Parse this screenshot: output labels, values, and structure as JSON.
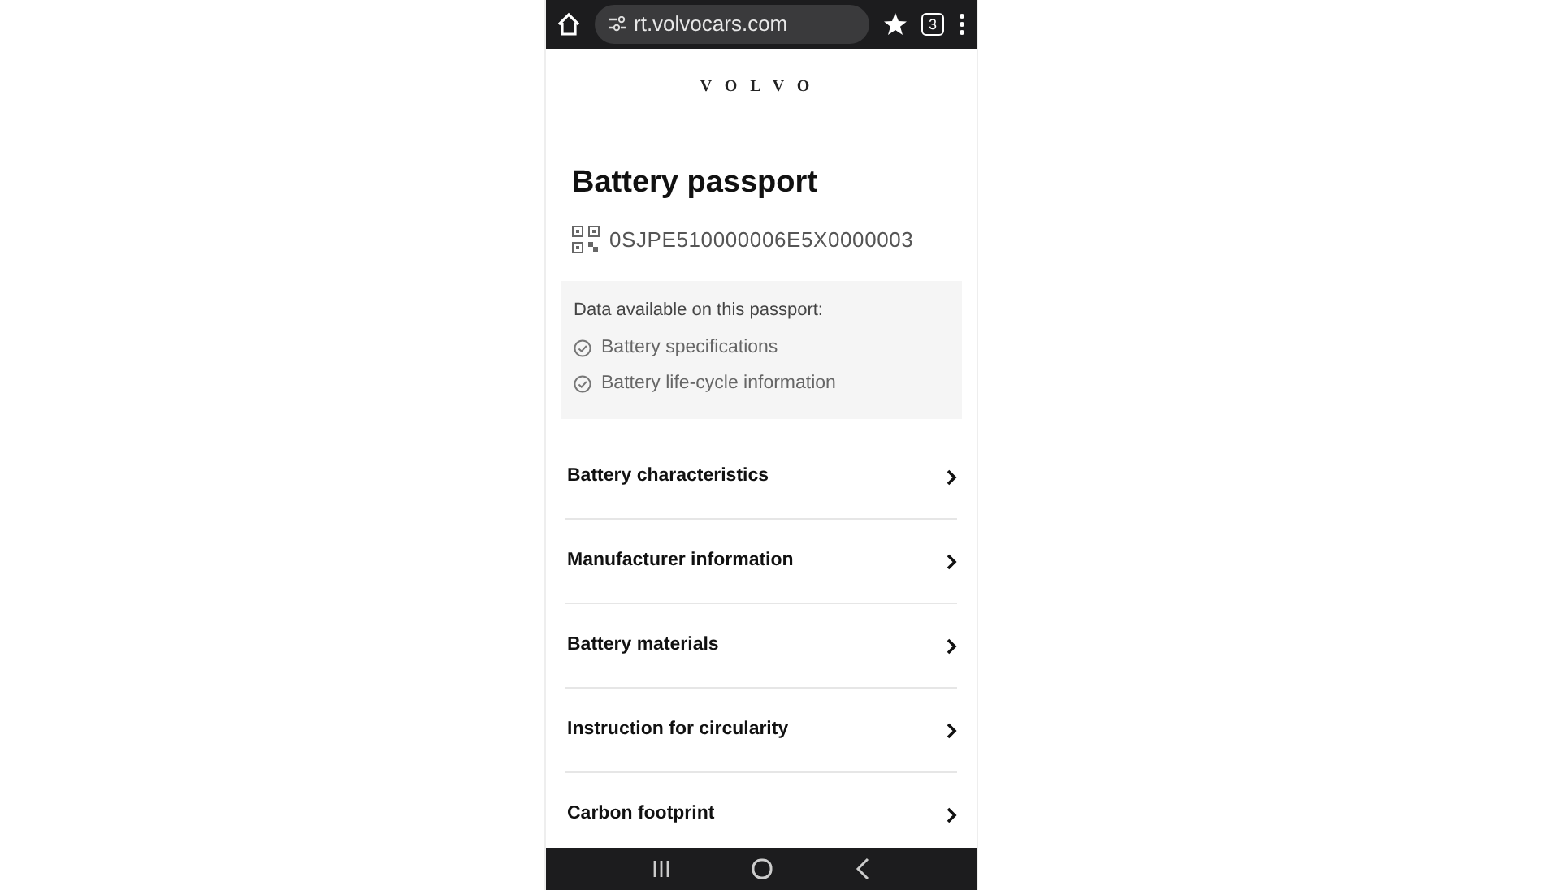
{
  "browser": {
    "address": "rt.volvocars.com",
    "tab_count": "3"
  },
  "brand": "VOLVO",
  "title": "Battery passport",
  "passport_id": "0SJPE510000006E5X0000003",
  "data_box": {
    "heading": "Data available on this passport:",
    "items": [
      "Battery specifications",
      "Battery life-cycle information"
    ]
  },
  "sections": [
    {
      "label": "Battery characteristics"
    },
    {
      "label": "Manufacturer information"
    },
    {
      "label": "Battery materials"
    },
    {
      "label": "Instruction for circularity"
    },
    {
      "label": "Carbon footprint"
    }
  ]
}
